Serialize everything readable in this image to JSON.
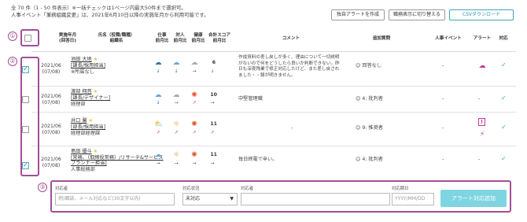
{
  "info": {
    "line1": "全 70 件（1 - 50 件表示）※一括チェックは1ページ内最大50件まで選択可。",
    "line2": "人事イベント「兼務組織変更」は、2021年6月10日以降の実施年月から利用可能です。"
  },
  "toolbar": {
    "create_alert": "独自アラートを作成",
    "toggle_display": "職務表示に切り替える",
    "csv_download": "CSVダウンロード"
  },
  "header": {
    "period": "実施年月\n(回答日)",
    "name": "氏名（役職/職種）\n組織名",
    "work": "仕事\n前月比",
    "relation": "対人\n前月比",
    "health": "健康\n前月比",
    "total": "合計スコア\n前月比",
    "comment": "コメント",
    "extra": "追加質問",
    "event": "人事イベント",
    "alert": "アラート",
    "action": "対応"
  },
  "callouts": {
    "c1": "①",
    "c2": "②",
    "c3": "③"
  },
  "rows": [
    {
      "date": "2021/06",
      "answer_date": "(07/08)",
      "name": "池田 大地",
      "role": "[課長/採用担当]",
      "org": "※所属なし",
      "score": "6",
      "comment": "作成資料の差し戻しが多く、理由について一切説明がないので何をどうしたら良いか判断できない。昨日も深夜残業で修正対応したけど、また差し戻されました・・録が明きません。",
      "extra_num": "",
      "extra_text": "回答なし",
      "event": "-",
      "checked": true
    },
    {
      "date": "2021/06",
      "answer_date": "(07/08)",
      "name": "渡部 翔音",
      "role": "[課長/デザイナー]",
      "org": "経理部",
      "score": "10",
      "comment": "中堅管理職",
      "extra_num": "4:",
      "extra_text": "批判者",
      "event": "-",
      "checked": false
    },
    {
      "date": "2021/06",
      "answer_date": "(07/08)",
      "name": "井口 馨",
      "role": "[部長/採用担当]",
      "org": "経理部経理課",
      "score": "11",
      "comment": "-",
      "extra_num": "9:",
      "extra_text": "推奨者",
      "event": "-",
      "checked": false
    },
    {
      "date": "2021/06",
      "answer_date": "(07/08)",
      "name": "島田 優斗",
      "role": "[常務、（取締役常務）/リサーチ&サービスプランナー担当]",
      "org": "人事総務部",
      "score": "11",
      "comment": "毎日終電で辛い。",
      "extra_num": "4:",
      "extra_text": "批判者",
      "event": "-",
      "checked": true
    }
  ],
  "form": {
    "target_label": "対応者",
    "target_placeholder": "例)面談、メール対応など(30文字以内)",
    "status_label": "対応状況",
    "status_value": "未対応",
    "person_label": "対応者",
    "deadline_label": "対応期日",
    "deadline_placeholder": "YYYY/MM/DD",
    "submit": "アラート対応追加"
  },
  "colors": {
    "accent": "#a24e97",
    "teal": "#3aa7ba",
    "submit": "#7fd4e1"
  }
}
